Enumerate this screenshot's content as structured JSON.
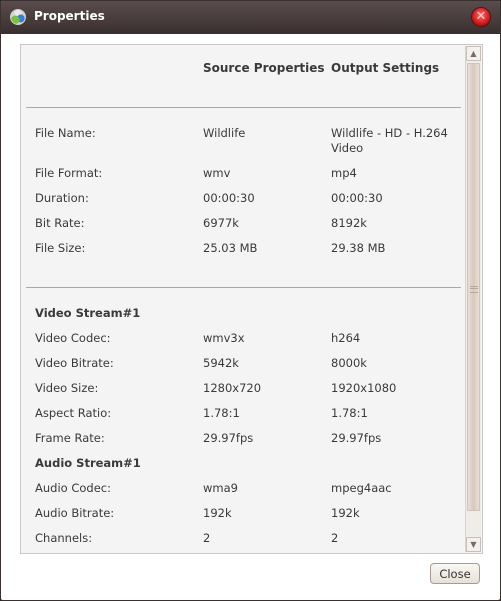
{
  "window": {
    "title": "Properties",
    "app_icon": "app-logo-icon",
    "close_icon": "close-icon"
  },
  "table": {
    "headers": {
      "label": "",
      "source": "Source Properties",
      "output": "Output Settings"
    },
    "general": [
      {
        "label": "File Name:",
        "source": "Wildlife",
        "output": "Wildlife - HD - H.264 Video"
      },
      {
        "label": "File Format:",
        "source": "wmv",
        "output": "mp4"
      },
      {
        "label": "Duration:",
        "source": "00:00:30",
        "output": "00:00:30"
      },
      {
        "label": "Bit Rate:",
        "source": "6977k",
        "output": "8192k"
      },
      {
        "label": "File Size:",
        "source": "25.03 MB",
        "output": "29.38 MB"
      }
    ],
    "video_section": "Video Stream#1",
    "video": [
      {
        "label": "Video Codec:",
        "source": "wmv3x",
        "output": "h264"
      },
      {
        "label": "Video Bitrate:",
        "source": "5942k",
        "output": "8000k"
      },
      {
        "label": "Video Size:",
        "source": "1280x720",
        "output": "1920x1080"
      },
      {
        "label": "Aspect Ratio:",
        "source": "1.78:1",
        "output": "1.78:1"
      },
      {
        "label": "Frame Rate:",
        "source": "29.97fps",
        "output": "29.97fps"
      }
    ],
    "audio_section": "Audio Stream#1",
    "audio": [
      {
        "label": "Audio Codec:",
        "source": "wma9",
        "output": "mpeg4aac"
      },
      {
        "label": "Audio Bitrate:",
        "source": "192k",
        "output": "192k"
      },
      {
        "label": "Channels:",
        "source": "2",
        "output": "2"
      }
    ]
  },
  "scrollbar": {
    "up_glyph": "▲",
    "down_glyph": "▼"
  },
  "footer": {
    "close_label": "Close"
  }
}
